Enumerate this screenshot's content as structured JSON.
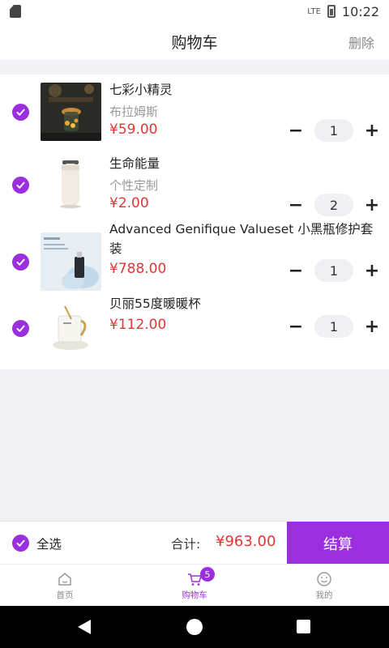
{
  "status_bar": {
    "network": "LTE",
    "time": "10:22"
  },
  "header": {
    "title": "购物车",
    "delete_label": "删除"
  },
  "cart_items": [
    {
      "name": "七彩小精灵",
      "spec": "布拉姆斯",
      "price": "¥59.00",
      "quantity": "1",
      "selected": true,
      "image_icon": "night-lamp-icon"
    },
    {
      "name": "生命能量",
      "spec": "个性定制",
      "price": "¥2.00",
      "quantity": "2",
      "selected": true,
      "image_icon": "thermos-icon"
    },
    {
      "name": "Advanced Genifique Valueset 小黑瓶修护套装",
      "spec": "",
      "price": "¥788.00",
      "quantity": "1",
      "selected": true,
      "image_icon": "serum-bottle-icon"
    },
    {
      "name": "贝丽55度暖暖杯",
      "spec": "",
      "price": "¥112.00",
      "quantity": "1",
      "selected": true,
      "image_icon": "warming-mug-icon"
    }
  ],
  "qty_controls": {
    "minus": "−",
    "plus": "+"
  },
  "bottom_bar": {
    "select_all_label": "全选",
    "total_label": "合计:",
    "total_amount": "¥963.00",
    "checkout_label": "结算"
  },
  "tabbar": [
    {
      "label": "首页",
      "icon": "home-icon",
      "active": false
    },
    {
      "label": "购物车",
      "icon": "cart-icon",
      "active": true,
      "badge": "5"
    },
    {
      "label": "我的",
      "icon": "smile-icon",
      "active": false
    }
  ],
  "colors": {
    "accent": "#9b2fe0",
    "price": "#e23636",
    "background": "#f2f2f6"
  }
}
